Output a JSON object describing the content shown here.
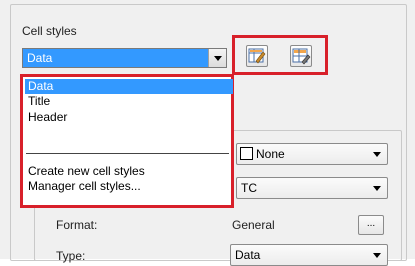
{
  "group_title": "Cell styles",
  "cell_style_combo": {
    "value": "Data"
  },
  "dropdown": {
    "items": [
      "Data",
      "Title",
      "Header"
    ],
    "actions": [
      "Create new cell styles",
      "Manager cell styles..."
    ]
  },
  "toolbar": {
    "buttons": [
      {
        "icon": "edit-cell-style-icon"
      },
      {
        "icon": "table-style-icon"
      }
    ]
  },
  "properties": {
    "fill_color": "None",
    "alignment": "TC",
    "format_label": "Format:",
    "format_value": "General",
    "format_button": "...",
    "type_label": "Type:",
    "type_value": "Data"
  },
  "colors": {
    "highlight": "#3399ff",
    "callout_red": "#d8202a"
  }
}
